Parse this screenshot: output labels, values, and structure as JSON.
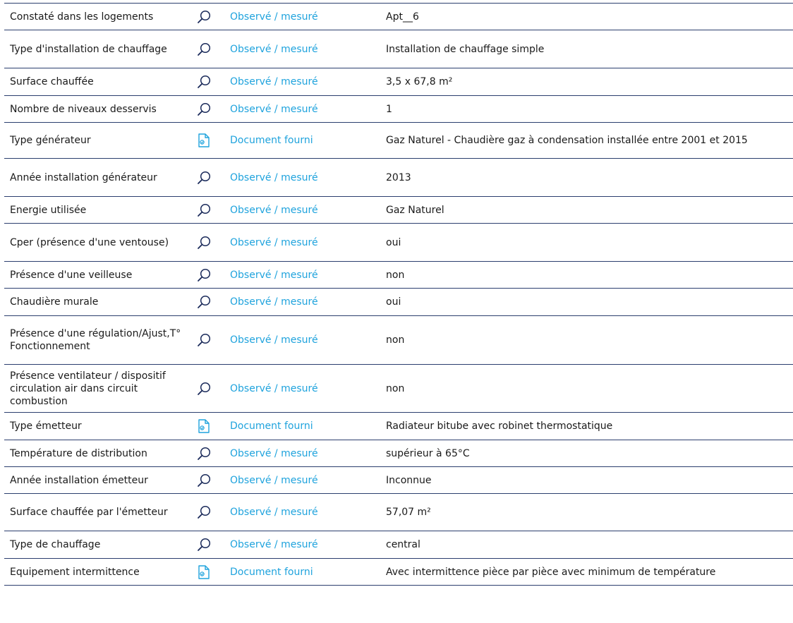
{
  "colors": {
    "border": "#2b3e6e",
    "source_text": "#1fa3dd",
    "icon": "#1a2a5a",
    "doc_icon": "#1fa3dd"
  },
  "rows": [
    {
      "label": "Constaté dans les logements",
      "source": "Observé / mesuré",
      "icon": "magnifier-icon",
      "value": "Apt__6"
    },
    {
      "label": "Type d'installation de chauffage",
      "source": "Observé / mesuré",
      "icon": "magnifier-icon",
      "value": "Installation de chauffage simple"
    },
    {
      "label": "Surface chauffée",
      "source": "Observé / mesuré",
      "icon": "magnifier-icon",
      "value": "3,5 x 67,8 m²"
    },
    {
      "label": "Nombre de niveaux desservis",
      "source": "Observé / mesuré",
      "icon": "magnifier-icon",
      "value": "1"
    },
    {
      "label": "Type générateur",
      "source": "Document fourni",
      "icon": "document-icon",
      "value": "Gaz Naturel - Chaudière gaz à condensation installée entre 2001 et 2015"
    },
    {
      "label": "Année installation générateur",
      "source": "Observé / mesuré",
      "icon": "magnifier-icon",
      "value": "2013"
    },
    {
      "label": "Energie utilisée",
      "source": "Observé / mesuré",
      "icon": "magnifier-icon",
      "value": "Gaz Naturel"
    },
    {
      "label": "Cper (présence d'une ventouse)",
      "source": "Observé / mesuré",
      "icon": "magnifier-icon",
      "value": "oui"
    },
    {
      "label": "Présence d'une veilleuse",
      "source": "Observé / mesuré",
      "icon": "magnifier-icon",
      "value": "non"
    },
    {
      "label": "Chaudière murale",
      "source": "Observé / mesuré",
      "icon": "magnifier-icon",
      "value": "oui"
    },
    {
      "label": "Présence d'une régulation/Ajust,T° Fonctionnement",
      "source": "Observé / mesuré",
      "icon": "magnifier-icon",
      "value": "non"
    },
    {
      "label": "Présence ventilateur / dispositif circulation air dans circuit combustion",
      "source": "Observé / mesuré",
      "icon": "magnifier-icon",
      "value": "non"
    },
    {
      "label": "Type émetteur",
      "source": "Document fourni",
      "icon": "document-icon",
      "value": "Radiateur bitube avec robinet thermostatique"
    },
    {
      "label": "Température de distribution",
      "source": "Observé / mesuré",
      "icon": "magnifier-icon",
      "value": "supérieur à 65°C"
    },
    {
      "label": "Année installation émetteur",
      "source": "Observé / mesuré",
      "icon": "magnifier-icon",
      "value": "Inconnue"
    },
    {
      "label": "Surface chauffée par l'émetteur",
      "source": "Observé / mesuré",
      "icon": "magnifier-icon",
      "value": "57,07 m²"
    },
    {
      "label": "Type de chauffage",
      "source": "Observé / mesuré",
      "icon": "magnifier-icon",
      "value": "central"
    },
    {
      "label": "Equipement intermittence",
      "source": "Document fourni",
      "icon": "document-icon",
      "value": "Avec intermittence pièce par pièce avec minimum de température"
    }
  ]
}
